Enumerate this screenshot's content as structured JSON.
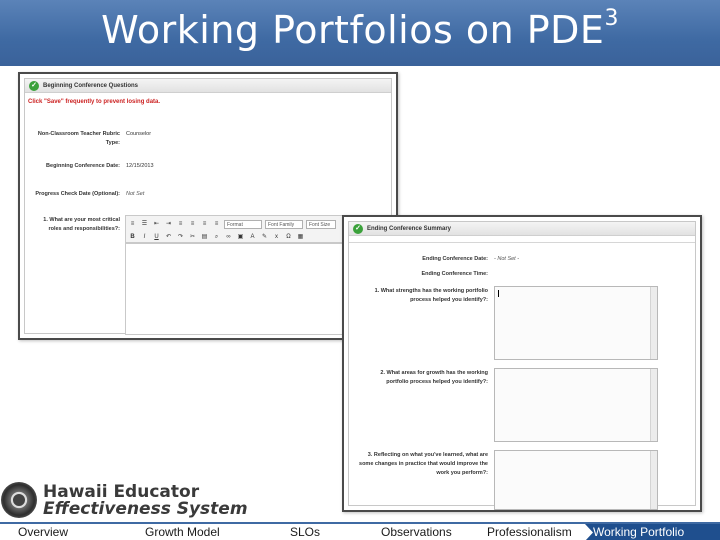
{
  "slide": {
    "title": "Working Portfolios on PDE",
    "title_superscript": "3",
    "header_color": "#3f6aa3"
  },
  "screenshot1": {
    "section_title": "Beginning Conference Questions",
    "warning": "Click \"Save\" frequently to prevent losing data.",
    "fields": [
      {
        "label": "Non-Classroom Teacher Rubric Type:",
        "value": "Counselor"
      },
      {
        "label": "Beginning Conference Date:",
        "value": "12/15/2013"
      },
      {
        "label": "Progress Check Date (Optional):",
        "value": "Not Set"
      },
      {
        "label": "1. What are your most critical roles and responsibilities?:",
        "value": ""
      }
    ],
    "toolbar": {
      "format": "Format",
      "font_family": "Font Family",
      "font_size": "Font Size"
    }
  },
  "screenshot2": {
    "section_title": "Ending Conference Summary",
    "fields": [
      {
        "label": "Ending Conference Date:",
        "value": "- Not Set -"
      },
      {
        "label": "Ending Conference Time:",
        "value": ""
      },
      {
        "label": "1. What strengths has the working portfolio process helped you identify?:",
        "value": ""
      },
      {
        "label": "2. What areas for growth has the working portfolio process helped you identify?:",
        "value": ""
      },
      {
        "label": "3. Reflecting on what you've learned, what are some changes in practice that would improve the work you perform?:",
        "value": ""
      }
    ]
  },
  "logo": {
    "line1": "Hawaii Educator",
    "line2": "Effectiveness System"
  },
  "nav": {
    "items": [
      "Overview",
      "Growth Model",
      "SLOs",
      "Observations",
      "Professionalism"
    ],
    "active": "Working Portfolio",
    "active_color": "#1f4f8e"
  }
}
